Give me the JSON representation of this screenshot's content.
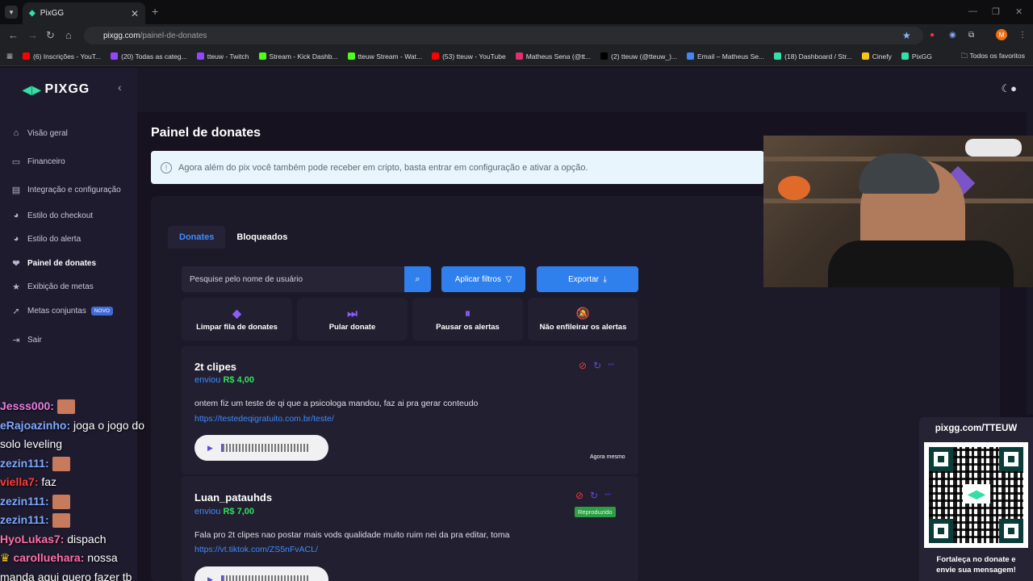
{
  "browser": {
    "tab_title": "PixGG",
    "url_host": "pixgg.com",
    "url_path": "/painel-de-donates",
    "bookmarks": [
      {
        "label": "(6) Inscrições - YouT...",
        "color": "#ff0000"
      },
      {
        "label": "(20) Todas as categ...",
        "color": "#9146ff"
      },
      {
        "label": "tteuw - Twitch",
        "color": "#9146ff"
      },
      {
        "label": "Stream - Kick Dashb...",
        "color": "#53fc18"
      },
      {
        "label": "tteuw Stream - Wat...",
        "color": "#53fc18"
      },
      {
        "label": "(53) tteuw - YouTube",
        "color": "#ff0000"
      },
      {
        "label": "Matheus Sena (@tt...",
        "color": "#e1306c"
      },
      {
        "label": "(2) tteuw (@tteuw_)...",
        "color": "#000000"
      },
      {
        "label": "Email – Matheus Se...",
        "color": "#4285f4"
      },
      {
        "label": "(18) Dashboard / Str...",
        "color": "#32e0a5"
      },
      {
        "label": "Cinefy",
        "color": "#f5c518"
      },
      {
        "label": "PixGG",
        "color": "#32e0a5"
      }
    ],
    "all_favorites": "Todos os favoritos",
    "profile_initial": "M"
  },
  "sidebar": {
    "brand": "PIXGG",
    "items": [
      {
        "label": "Visão geral",
        "icon": "home-icon"
      },
      {
        "label": "Financeiro",
        "icon": "wallet-icon"
      },
      {
        "label": "Integração e configuração",
        "icon": "settings-icon"
      },
      {
        "label": "Estilo do checkout",
        "icon": "palette-icon"
      },
      {
        "label": "Estilo do alerta",
        "icon": "palette-icon"
      },
      {
        "label": "Painel de donates",
        "icon": "heart-hand-icon"
      },
      {
        "label": "Exibição de metas",
        "icon": "star-icon"
      },
      {
        "label": "Metas conjuntas",
        "icon": "rocket-icon",
        "badge": "NOVO"
      },
      {
        "label": "Sair",
        "icon": "logout-icon"
      }
    ]
  },
  "chat": [
    {
      "user": "Jesss000:",
      "color": "#e87de0",
      "text": "",
      "emote": true
    },
    {
      "user": "eRajoazinho:",
      "color": "#7fa8ff",
      "text": "joga o jogo do"
    },
    {
      "user": "",
      "color": "#fff",
      "text": "solo leveling"
    },
    {
      "user": "zezin111:",
      "color": "#7fa8ff",
      "text": "",
      "emote": true
    },
    {
      "user": "viella7:",
      "color": "#ff3b3b",
      "text": "faz"
    },
    {
      "user": "zezin111:",
      "color": "#7fa8ff",
      "text": "",
      "emote": true
    },
    {
      "user": "zezin111:",
      "color": "#7fa8ff",
      "text": "",
      "emote": true
    },
    {
      "user": "HyoLukas7:",
      "color": "#ff6fa8",
      "text": "dispach"
    },
    {
      "user": "carolluehara:",
      "color": "#ff6fa8",
      "text": "nossa",
      "crown": true
    },
    {
      "user": "",
      "color": "#fff",
      "text": "manda aqui quero fazer tb"
    }
  ],
  "main": {
    "title": "Painel de donates",
    "info": "Agora além do pix você também pode receber em cripto, basta entrar em configuração e ativar a opção.",
    "tabs": [
      "Donates",
      "Bloqueados"
    ],
    "search_placeholder": "Pesquise pelo nome de usuário",
    "filter_label": "Aplicar filtros",
    "export_label": "Exportar",
    "actions": [
      "Limpar fila de donates",
      "Pular donate",
      "Pausar os alertas",
      "Não enfileirar os alertas"
    ],
    "donates": [
      {
        "name": "2t clipes",
        "sent_label": "enviou",
        "amount": "R$ 4,00",
        "message": "ontem fiz um teste de qi que a psicologa mandou, faz ai pra gerar conteudo",
        "link": "https://testedeqigratuito.com.br/teste/",
        "time": "Agora mesmo"
      },
      {
        "name": "Luan_patauhds",
        "sent_label": "enviou",
        "amount": "R$ 7,00",
        "status": "Reproduzido",
        "message": "Fala pro 2t clipes nao postar mais vods qualidade muito ruim nei da pra editar, toma",
        "link": "https://vt.tiktok.com/ZS5nFvACL/"
      }
    ]
  },
  "qr": {
    "title": "pixgg.com/TTEUW",
    "footer_line1": "Fortaleça no donate e",
    "footer_line2": "envie sua mensagem!"
  }
}
